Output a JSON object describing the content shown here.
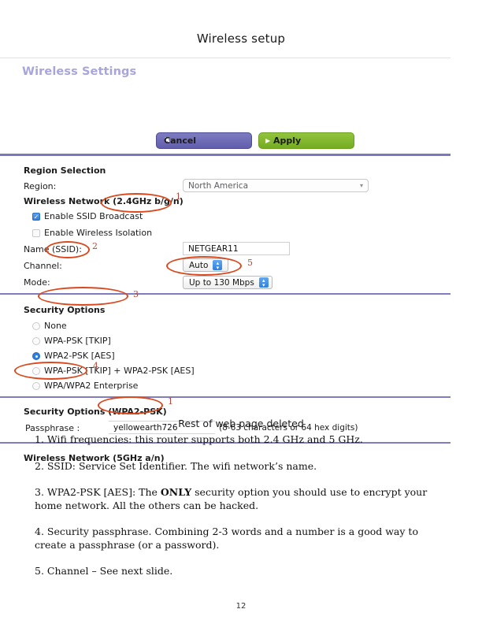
{
  "slide": {
    "title": "Wireless setup",
    "page_number": "12",
    "deleted_note": "Rest of web page deleted"
  },
  "router_ui": {
    "panel_title": "Wireless Settings",
    "buttons": {
      "cancel": {
        "label": "Cancel",
        "icon": "close-icon",
        "glyph": "✖",
        "color": "#615ead"
      },
      "apply": {
        "label": "Apply",
        "icon": "play-triangle-icon",
        "glyph": "▶",
        "color": "#75ac22"
      }
    },
    "region_section": {
      "heading": "Region Selection",
      "region_label": "Region:",
      "region_value": "North America"
    },
    "network_24": {
      "heading_prefix": "Wireless Network ",
      "heading_band": "(2.4GHz b/g/n)",
      "ssid_broadcast_label": "Enable SSID Broadcast",
      "ssid_broadcast_checked": true,
      "wireless_isolation_label": "Enable Wireless Isolation",
      "wireless_isolation_checked": false,
      "name_label_prefix": "Nam",
      "name_label_ssid": "e (SSID):",
      "name_value": "NETGEAR11",
      "channel_label": "Channel:",
      "channel_value": "Auto",
      "mode_label": "Mode:",
      "mode_value": "Up to 130 Mbps"
    },
    "security": {
      "heading": "Security Options",
      "options": [
        {
          "label": "None",
          "selected": false
        },
        {
          "label": "WPA-PSK [TKIP]",
          "selected": false
        },
        {
          "label": "WPA2-PSK [AES]",
          "selected": true
        },
        {
          "label": "WPA-PSK [TKIP] + WPA2-PSK [AES]",
          "selected": false
        },
        {
          "label": "WPA/WPA2 Enterprise",
          "selected": false
        }
      ]
    },
    "passphrase_section": {
      "heading": "Security Options (WPA2-PSK)",
      "label": "Passphrase :",
      "value": "yellowearth726",
      "hint": "(8-63 characters or 64 hex digits)"
    },
    "network_5": {
      "heading_prefix": "Wireless Networ",
      "heading_band": "k (5GHz a/n)"
    }
  },
  "annotations": {
    "color": "#d9491d",
    "numbers": [
      "1",
      "2",
      "3",
      "4",
      "5",
      "1"
    ]
  },
  "notes": [
    {
      "lead": "1. ",
      "text": "Wifi frequencies: this router supports both 2.4 GHz and 5 GHz."
    },
    {
      "lead": "2. ",
      "text": "SSID: Service Set Identifier. The wifi network’s name."
    },
    {
      "lead": "3. ",
      "pre": "WPA2-PSK [AES]: The ",
      "bold": "ONLY",
      "post": " security option you should use to encrypt your home network. All the others can be hacked."
    },
    {
      "lead": "4. ",
      "text": "Security passphrase. Combining 2-3 words and a number is a good way to create a passphrase (or a password)."
    },
    {
      "lead": "5. ",
      "text": "Channel – See next slide."
    }
  ]
}
